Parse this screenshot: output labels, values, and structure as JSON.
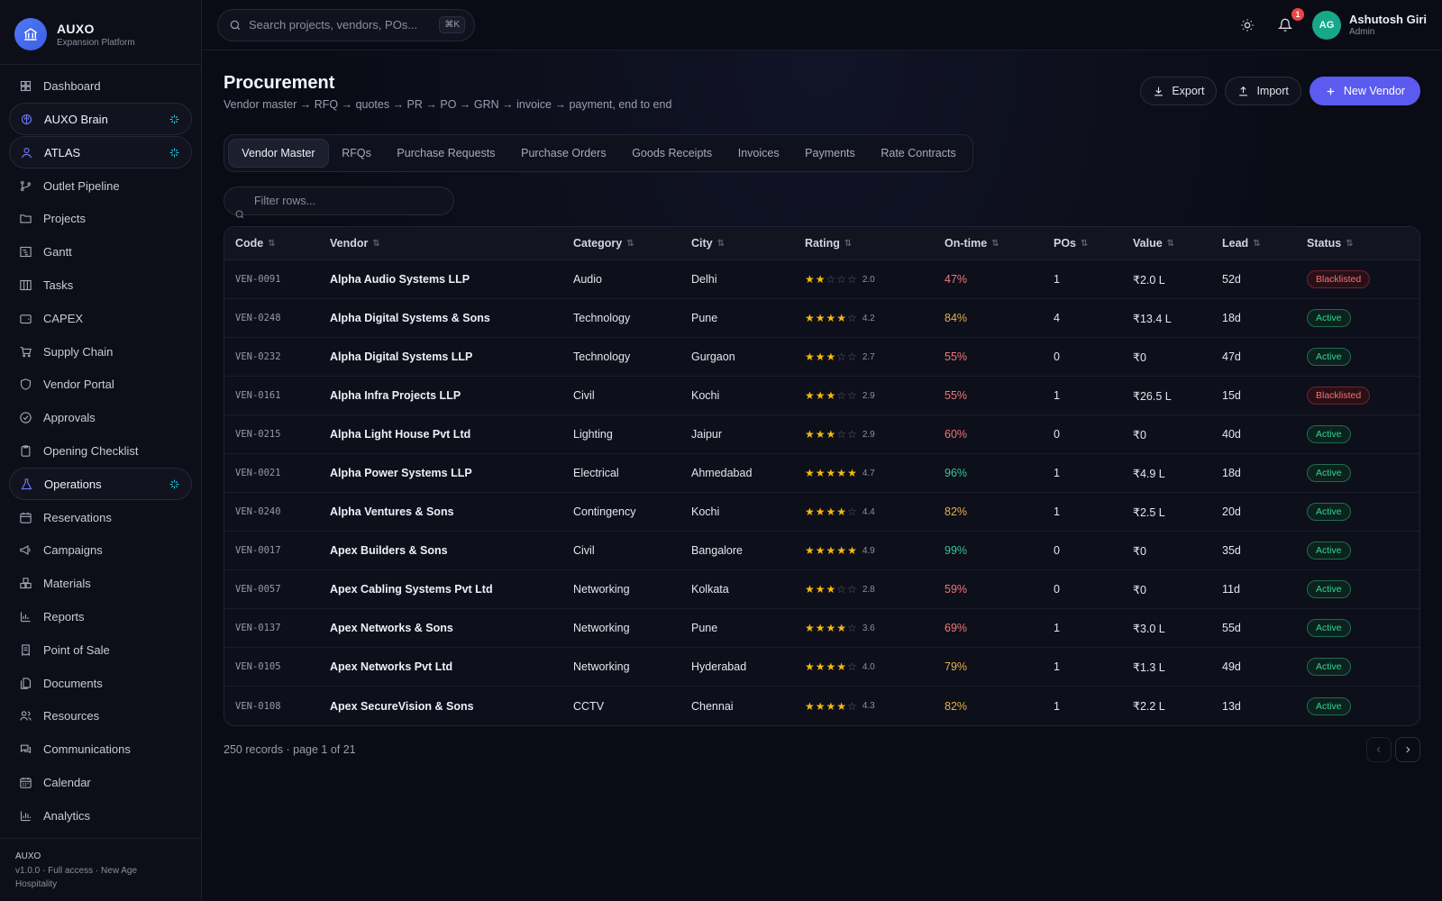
{
  "brand": {
    "title": "AUXO",
    "subtitle": "Expansion Platform"
  },
  "nav": [
    {
      "label": "Dashboard",
      "icon": "grid-icon"
    },
    {
      "label": "AUXO Brain",
      "icon": "brain-icon",
      "pill": true,
      "spark": true
    },
    {
      "label": "ATLAS",
      "icon": "user-icon",
      "pill": true,
      "spark": true
    },
    {
      "label": "Outlet Pipeline",
      "icon": "git-branch-icon"
    },
    {
      "label": "Projects",
      "icon": "folder-icon"
    },
    {
      "label": "Gantt",
      "icon": "gantt-icon"
    },
    {
      "label": "Tasks",
      "icon": "kanban-icon"
    },
    {
      "label": "CAPEX",
      "icon": "wallet-icon"
    },
    {
      "label": "Supply Chain",
      "icon": "cart-icon"
    },
    {
      "label": "Vendor Portal",
      "icon": "shield-icon"
    },
    {
      "label": "Approvals",
      "icon": "check-circle-icon"
    },
    {
      "label": "Opening Checklist",
      "icon": "clipboard-icon"
    },
    {
      "label": "Operations",
      "icon": "flask-icon",
      "pill": true,
      "spark": true
    },
    {
      "label": "Reservations",
      "icon": "calendar-icon"
    },
    {
      "label": "Campaigns",
      "icon": "megaphone-icon"
    },
    {
      "label": "Materials",
      "icon": "boxes-icon"
    },
    {
      "label": "Reports",
      "icon": "bar-chart-icon"
    },
    {
      "label": "Point of Sale",
      "icon": "receipt-icon"
    },
    {
      "label": "Documents",
      "icon": "files-icon"
    },
    {
      "label": "Resources",
      "icon": "users-icon"
    },
    {
      "label": "Communications",
      "icon": "messages-icon"
    },
    {
      "label": "Calendar",
      "icon": "calendar-days-icon"
    },
    {
      "label": "Analytics",
      "icon": "analytics-icon"
    }
  ],
  "footer": {
    "title": "AUXO",
    "line1": "v1.0.0 · Full access · New Age",
    "line2": "Hospitality"
  },
  "search": {
    "placeholder": "Search projects, vendors, POs...",
    "shortcut": "⌘K"
  },
  "user": {
    "initials": "AG",
    "name": "Ashutosh Giri",
    "role": "Admin",
    "notifications": "1"
  },
  "page": {
    "title": "Procurement",
    "subtitle": "Vendor master → RFQ → quotes → PR → PO → GRN → invoice → payment, end to end"
  },
  "actions": {
    "export": "Export",
    "import": "Import",
    "new_vendor": "New Vendor"
  },
  "tabs": [
    "Vendor Master",
    "RFQs",
    "Purchase Requests",
    "Purchase Orders",
    "Goods Receipts",
    "Invoices",
    "Payments",
    "Rate Contracts"
  ],
  "filter": {
    "placeholder": "Filter rows..."
  },
  "columns": [
    "Code",
    "Vendor",
    "Category",
    "City",
    "Rating",
    "On-time",
    "POs",
    "Value",
    "Lead",
    "Status"
  ],
  "rows": [
    {
      "code": "VEN-0091",
      "vendor": "Alpha Audio Systems LLP",
      "category": "Audio",
      "city": "Delhi",
      "stars": 2,
      "rating": "2.0",
      "ontime": "47%",
      "tone": "red",
      "pos": "1",
      "value": "₹2.0 L",
      "lead": "52d",
      "status": "Blacklisted"
    },
    {
      "code": "VEN-0248",
      "vendor": "Alpha Digital Systems & Sons",
      "category": "Technology",
      "city": "Pune",
      "stars": 4,
      "rating": "4.2",
      "ontime": "84%",
      "tone": "amber",
      "pos": "4",
      "value": "₹13.4 L",
      "lead": "18d",
      "status": "Active"
    },
    {
      "code": "VEN-0232",
      "vendor": "Alpha Digital Systems LLP",
      "category": "Technology",
      "city": "Gurgaon",
      "stars": 3,
      "rating": "2.7",
      "ontime": "55%",
      "tone": "red",
      "pos": "0",
      "value": "₹0",
      "lead": "47d",
      "status": "Active"
    },
    {
      "code": "VEN-0161",
      "vendor": "Alpha Infra Projects LLP",
      "category": "Civil",
      "city": "Kochi",
      "stars": 3,
      "rating": "2.9",
      "ontime": "55%",
      "tone": "red",
      "pos": "1",
      "value": "₹26.5 L",
      "lead": "15d",
      "status": "Blacklisted"
    },
    {
      "code": "VEN-0215",
      "vendor": "Alpha Light House Pvt Ltd",
      "category": "Lighting",
      "city": "Jaipur",
      "stars": 3,
      "rating": "2.9",
      "ontime": "60%",
      "tone": "red",
      "pos": "0",
      "value": "₹0",
      "lead": "40d",
      "status": "Active"
    },
    {
      "code": "VEN-0021",
      "vendor": "Alpha Power Systems LLP",
      "category": "Electrical",
      "city": "Ahmedabad",
      "stars": 5,
      "rating": "4.7",
      "ontime": "96%",
      "tone": "green",
      "pos": "1",
      "value": "₹4.9 L",
      "lead": "18d",
      "status": "Active"
    },
    {
      "code": "VEN-0240",
      "vendor": "Alpha Ventures & Sons",
      "category": "Contingency",
      "city": "Kochi",
      "stars": 4,
      "rating": "4.4",
      "ontime": "82%",
      "tone": "amber",
      "pos": "1",
      "value": "₹2.5 L",
      "lead": "20d",
      "status": "Active"
    },
    {
      "code": "VEN-0017",
      "vendor": "Apex Builders & Sons",
      "category": "Civil",
      "city": "Bangalore",
      "stars": 5,
      "rating": "4.9",
      "ontime": "99%",
      "tone": "green",
      "pos": "0",
      "value": "₹0",
      "lead": "35d",
      "status": "Active"
    },
    {
      "code": "VEN-0057",
      "vendor": "Apex Cabling Systems Pvt Ltd",
      "category": "Networking",
      "city": "Kolkata",
      "stars": 3,
      "rating": "2.8",
      "ontime": "59%",
      "tone": "red",
      "pos": "0",
      "value": "₹0",
      "lead": "11d",
      "status": "Active"
    },
    {
      "code": "VEN-0137",
      "vendor": "Apex Networks & Sons",
      "category": "Networking",
      "city": "Pune",
      "stars": 4,
      "rating": "3.6",
      "ontime": "69%",
      "tone": "red",
      "pos": "1",
      "value": "₹3.0 L",
      "lead": "55d",
      "status": "Active"
    },
    {
      "code": "VEN-0105",
      "vendor": "Apex Networks Pvt Ltd",
      "category": "Networking",
      "city": "Hyderabad",
      "stars": 4,
      "rating": "4.0",
      "ontime": "79%",
      "tone": "amber",
      "pos": "1",
      "value": "₹1.3 L",
      "lead": "49d",
      "status": "Active"
    },
    {
      "code": "VEN-0108",
      "vendor": "Apex SecureVision & Sons",
      "category": "CCTV",
      "city": "Chennai",
      "stars": 4,
      "rating": "4.3",
      "ontime": "82%",
      "tone": "amber",
      "pos": "1",
      "value": "₹2.2 L",
      "lead": "13d",
      "status": "Active"
    }
  ],
  "records": "250 records · page 1 of 21",
  "colors": {
    "primary": "#5b5bf0",
    "active": "#34d399",
    "blacklisted": "#f87171",
    "star": "#f5b90f"
  }
}
